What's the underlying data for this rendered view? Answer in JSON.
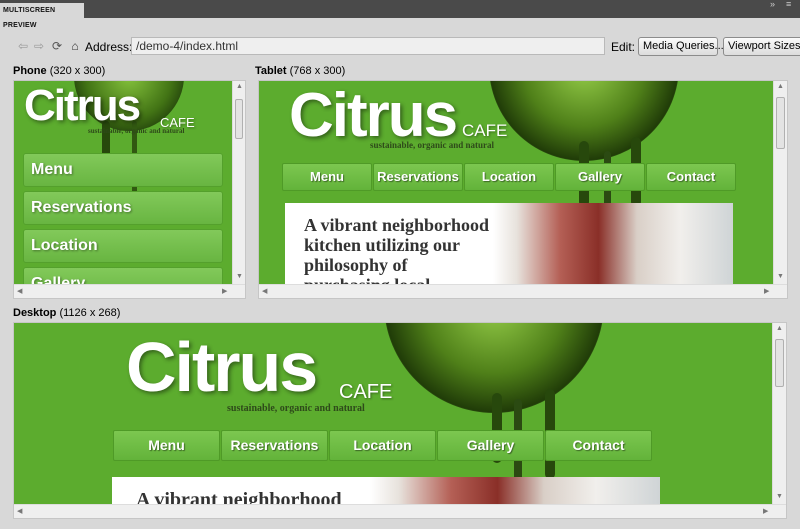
{
  "panel": {
    "tab_label": "MULTISCREEN PREVIEW",
    "controls": "▸▸ ≡"
  },
  "toolbar": {
    "back_icon": "back-arrow-icon",
    "forward_icon": "forward-arrow-icon",
    "refresh_icon": "refresh-icon",
    "home_icon": "home-icon",
    "address_label": "Address:",
    "address_value": "/demo-4/index.html",
    "edit_label": "Edit:",
    "media_queries_label": "Media Queries...",
    "viewport_sizes_label": "Viewport Sizes..."
  },
  "frames": {
    "phone": {
      "name": "Phone",
      "size": "(320 x 300)"
    },
    "tablet": {
      "name": "Tablet",
      "size": "(768 x 300)"
    },
    "desktop": {
      "name": "Desktop",
      "size": "(1126 x 268)"
    }
  },
  "site": {
    "logo": "Citrus",
    "cafe": "CAFE",
    "tagline": "sustainable, organic and natural",
    "nav": [
      "Menu",
      "Reservations",
      "Location",
      "Gallery",
      "Contact"
    ],
    "hero_text": "A vibrant neighborhood kitchen utilizing our philosophy of purchasing local",
    "tablet_hero_lines": [
      "A vibrant neighborhood",
      "kitchen utilizing our",
      "philosophy of",
      "purchasing local"
    ],
    "desktop_hero_line": "A vibrant neighborhood",
    "colors": {
      "green": "#5cac2e",
      "nav_green": "#6cbb44",
      "dark_lime": "#2b4a12"
    }
  }
}
